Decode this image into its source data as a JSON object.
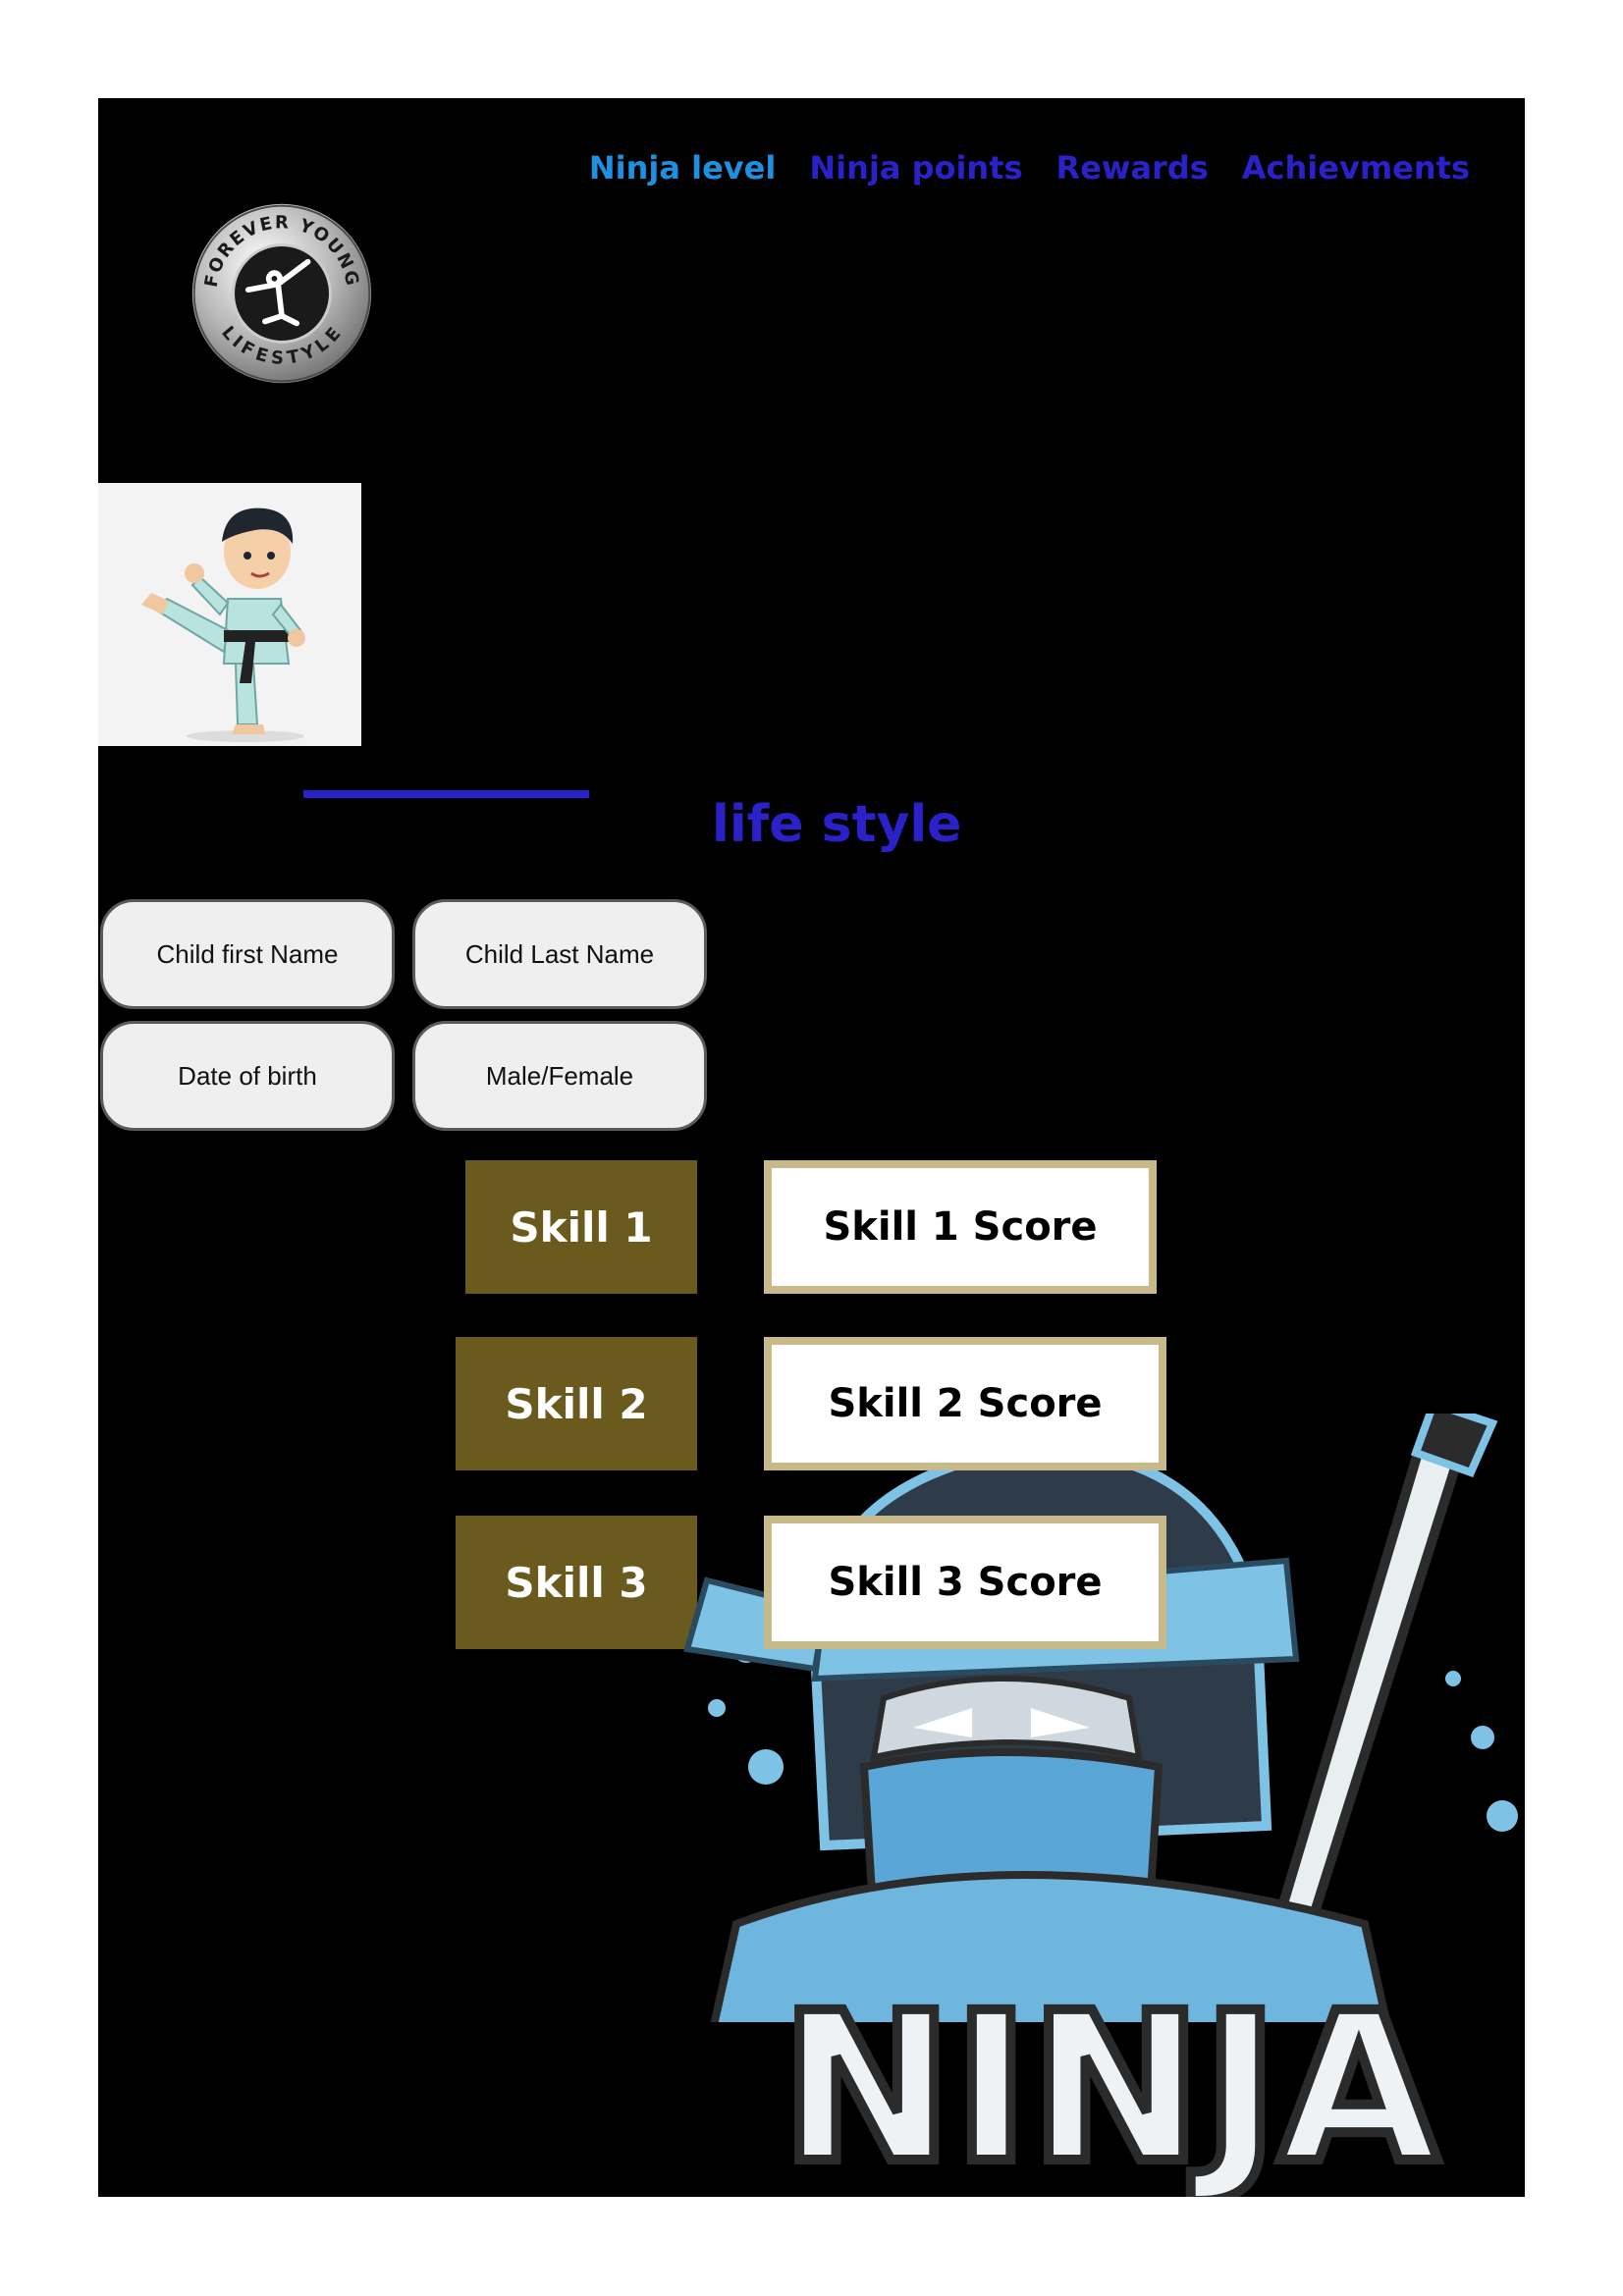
{
  "nav": {
    "items": [
      {
        "label": "Ninja level"
      },
      {
        "label": "Ninja points"
      },
      {
        "label": "Rewards"
      },
      {
        "label": "Achievments"
      }
    ]
  },
  "logo": {
    "top_text": "FOREVER YOUNG",
    "bottom_text": "LIFESTYLE"
  },
  "headline": "life style",
  "form": {
    "first_name_placeholder": "Child first Name",
    "last_name_placeholder": "Child Last Name",
    "dob_placeholder": "Date of birth",
    "gender_placeholder": "Male/Female"
  },
  "skills": [
    {
      "label": "Skill 1",
      "score": "Skill 1 Score"
    },
    {
      "label": "Skill 2",
      "score": "Skill 2 Score"
    },
    {
      "label": "Skill 3",
      "score": "Skill 3 Score"
    }
  ],
  "mascot": {
    "text": "NINJA"
  },
  "colors": {
    "background": "#000000",
    "nav_link": "#2a22c8",
    "nav_active": "#1f8fe0",
    "skill_fill": "#6a5a1e",
    "score_border": "#c8b98a"
  },
  "icons": [
    "forever-young-logo-icon",
    "karate-kid-icon",
    "ninja-mascot-icon"
  ]
}
